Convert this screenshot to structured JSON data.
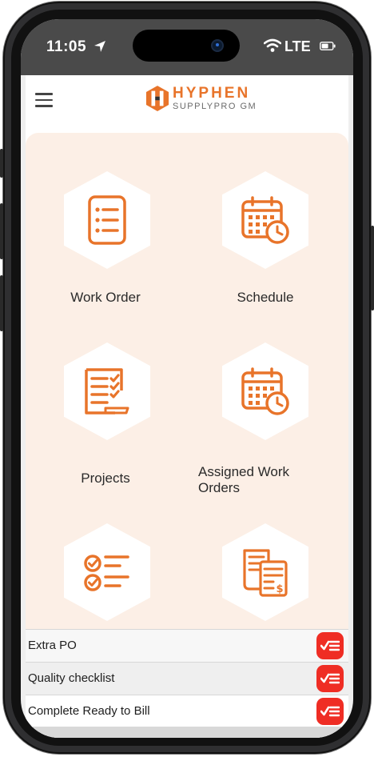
{
  "status_bar": {
    "time": "11:05",
    "network": "LTE"
  },
  "app_bar": {
    "logo_main": "HYPHEN",
    "logo_sub": "SUPPLYPRO GM"
  },
  "tiles": [
    {
      "label": "Work Order",
      "icon": "clipboard-list-icon"
    },
    {
      "label": "Schedule",
      "icon": "calendar-clock-icon"
    },
    {
      "label": "Projects",
      "icon": "checklist-document-icon"
    },
    {
      "label": "Assigned Work Orders",
      "icon": "calendar-clock-icon"
    },
    {
      "label": "",
      "icon": "checklist-icon"
    },
    {
      "label": "",
      "icon": "invoice-icon"
    }
  ],
  "list": [
    {
      "label": "Extra PO"
    },
    {
      "label": "Quality checklist"
    },
    {
      "label": "Complete Ready to Bill"
    }
  ],
  "colors": {
    "accent": "#e8742a",
    "panel": "#fcefe6",
    "check_button": "#ef2d24"
  }
}
